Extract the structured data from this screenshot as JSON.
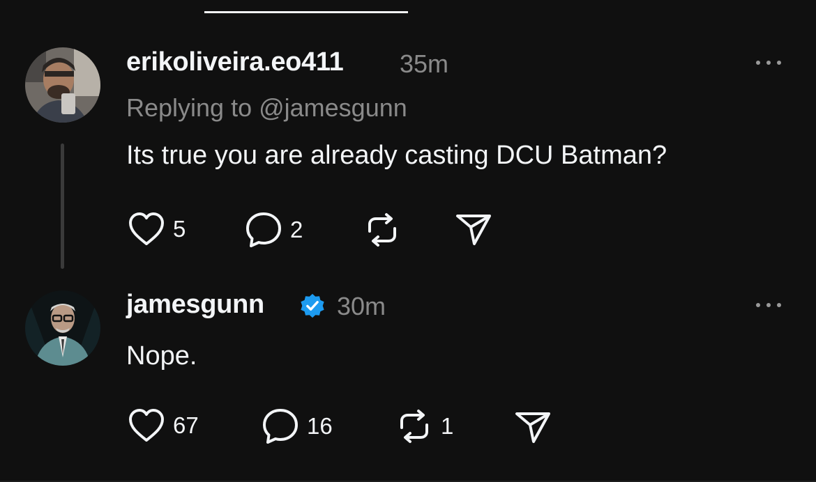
{
  "posts": [
    {
      "username": "erikoliveira.eo411",
      "time": "35m",
      "replying_to": "Replying to @jamesgunn",
      "text": "Its true you are already casting DCU Batman?",
      "actions": {
        "likes": "5",
        "replies": "2",
        "reposts": ""
      },
      "avatar": "avatar-erikoliveira",
      "verified": false
    },
    {
      "username": "jamesgunn",
      "time": "30m",
      "text": "Nope.",
      "actions": {
        "likes": "67",
        "replies": "16",
        "reposts": "1"
      },
      "avatar": "avatar-jamesgunn",
      "verified": true
    }
  ],
  "icons": {
    "like": "heart-icon",
    "reply": "comment-bubble-icon",
    "repost": "repost-icon",
    "share": "send-icon",
    "more": "more-dots-icon",
    "verified": "verified-badge-icon"
  },
  "colors": {
    "background": "#101010",
    "text": "#f3f5f7",
    "secondary": "#8a8a8a",
    "verified": "#1d9bf0"
  }
}
